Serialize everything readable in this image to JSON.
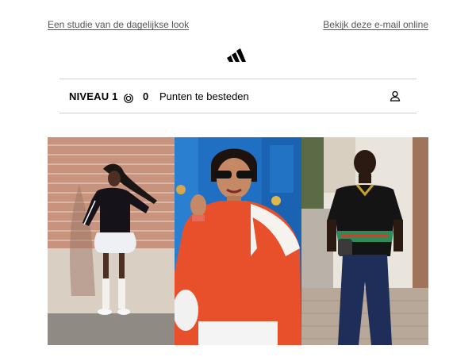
{
  "header": {
    "left_link": "Een studie van de dagelijkse look",
    "right_link": "Bekijk deze e-mail online"
  },
  "brand": {
    "logo_icon": "adidas-logo-icon"
  },
  "loyalty": {
    "level": "NIVEAU 1",
    "coin_icon": "points-coin-icon",
    "points": "0",
    "points_label": "Punten te besteden",
    "profile_icon": "user-icon"
  },
  "hero": {
    "photos": [
      {
        "subject": "woman-brick-wall"
      },
      {
        "subject": "woman-red-jacket"
      },
      {
        "subject": "man-jersey"
      }
    ]
  }
}
